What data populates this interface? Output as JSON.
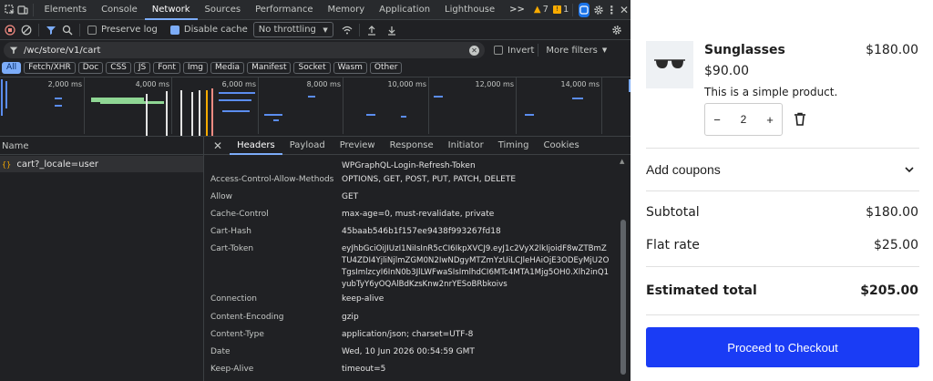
{
  "devtools": {
    "tabs": [
      "Elements",
      "Console",
      "Network",
      "Sources",
      "Performance",
      "Memory",
      "Application",
      "Lighthouse"
    ],
    "more_tabs": ">>",
    "warning_count": "7",
    "issue_count": "1",
    "toolbar": {
      "preserve_log": "Preserve log",
      "disable_cache": "Disable cache",
      "throttling": "No throttling"
    },
    "filter": {
      "value": "/wc/store/v1/cart",
      "invert": "Invert",
      "more_filters": "More filters"
    },
    "type_filters": [
      "All",
      "Fetch/XHR",
      "Doc",
      "CSS",
      "JS",
      "Font",
      "Img",
      "Media",
      "Manifest",
      "Socket",
      "Wasm",
      "Other"
    ],
    "timeline_ticks": [
      "2,000 ms",
      "4,000 ms",
      "6,000 ms",
      "8,000 ms",
      "10,000 ms",
      "12,000 ms",
      "14,000 ms"
    ],
    "request_list": {
      "header": "Name",
      "rows": [
        {
          "icon": "{}",
          "name": "cart?_locale=user"
        }
      ]
    },
    "detail_tabs": [
      "Headers",
      "Payload",
      "Preview",
      "Response",
      "Initiator",
      "Timing",
      "Cookies"
    ],
    "partial_header_value": "WPGraphQL-Login-Refresh-Token",
    "headers": [
      {
        "name": "Access-Control-Allow-Methods",
        "value": "OPTIONS, GET, POST, PUT, PATCH, DELETE"
      },
      {
        "name": "Allow",
        "value": "GET"
      },
      {
        "name": "Cache-Control",
        "value": "max-age=0, must-revalidate, private"
      },
      {
        "name": "Cart-Hash",
        "value": "45baab546b1f157ee9438f993267fd18"
      },
      {
        "name": "Cart-Token",
        "value": "eyJhbGciOiJIUzI1NiIsInR5cCI6IkpXVCJ9.eyJ1c2VyX2lkIjoidF8wZTBmZTU4ZDI4YjliNjlmZGM0N2IwNDgyMTZmYzUiLCJleHAiOjE3ODEyMjU2OTgsImlzcyI6InN0b3JlLWFwaSIsImlhdCI6MTc4MTA1Mjg5OH0.Xlh2inQ1yubTyY6yOQAlBdKzsKnw2nrYESoBRbkoivs"
      },
      {
        "name": "Connection",
        "value": "keep-alive"
      },
      {
        "name": "Content-Encoding",
        "value": "gzip"
      },
      {
        "name": "Content-Type",
        "value": "application/json; charset=UTF-8"
      },
      {
        "name": "Date",
        "value": "Wed, 10 Jun 2026 00:54:59 GMT"
      },
      {
        "name": "Keep-Alive",
        "value": "timeout=5"
      }
    ]
  },
  "cart": {
    "product": {
      "name": "Sunglasses",
      "line_total": "$180.00",
      "unit_price": "$90.00",
      "description": "This is a simple product.",
      "quantity": "2",
      "minus": "−",
      "plus": "+"
    },
    "add_coupons": "Add coupons",
    "subtotal_label": "Subtotal",
    "subtotal_value": "$180.00",
    "shipping_label": "Flat rate",
    "shipping_value": "$25.00",
    "total_label": "Estimated total",
    "total_value": "$205.00",
    "checkout_button": "Proceed to Checkout",
    "colors": {
      "button": "#1a3cf5",
      "text": "#1e1e1e"
    }
  }
}
